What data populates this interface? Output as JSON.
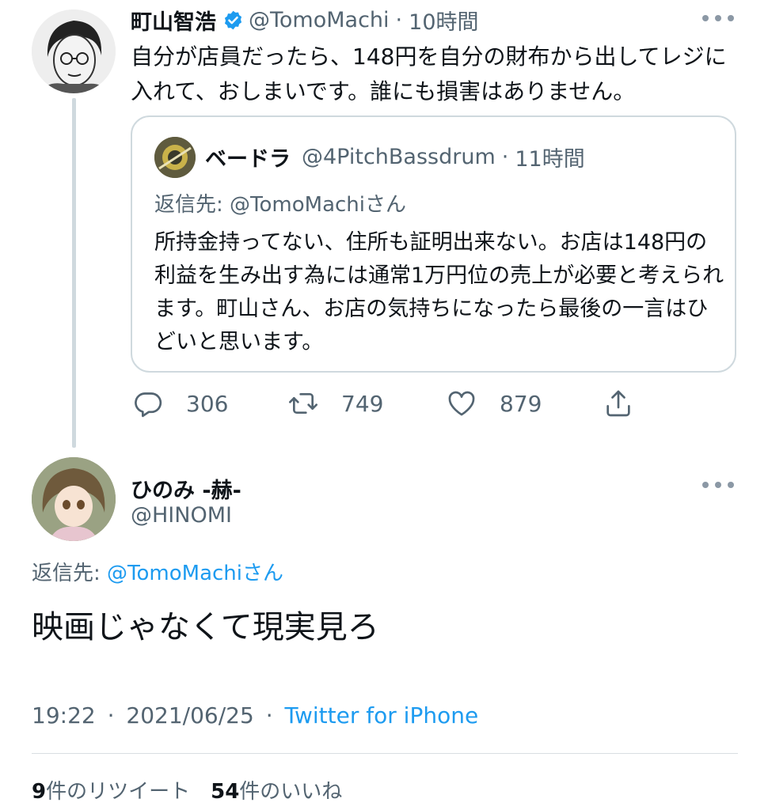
{
  "original_tweet": {
    "author_name": "町山智浩",
    "handle": "@TomoMachi",
    "separator": "·",
    "time_ago": "10時間",
    "text": "自分が店員だったら、148円を自分の財布から出してレジに入れて、おしまいです。誰にも損害はありません。",
    "quoted_tweet": {
      "author_name": "ベードラ",
      "handle": "@4PitchBassdrum",
      "separator": "·",
      "time_ago": "11時間",
      "reply_prefix": "返信先: ",
      "reply_target": "@TomoMachiさん",
      "text": "所持金持ってない、住所も証明出来ない。お店は148円の利益を生み出す為には通常1万円位の売上が必要と考えられます。町山さん、お店の気持ちになったら最後の一言はひどいと思います。"
    },
    "actions": {
      "reply_count": "306",
      "retweet_count": "749",
      "like_count": "879"
    }
  },
  "reply_tweet": {
    "author_name": "ひのみ -赫-",
    "handle": "@HINOMI",
    "reply_prefix": "返信先: ",
    "reply_target": "@TomoMachiさん",
    "text": "映画じゃなくて現実見ろ",
    "time": "19:22",
    "separator": "·",
    "date": "2021/06/25",
    "source": "Twitter for iPhone",
    "retweet_count": "9",
    "retweet_label": "件のリツイート",
    "like_count": "54",
    "like_label": "件のいいね"
  },
  "colors": {
    "link": "#1d9bf0",
    "muted_text": "#536471",
    "verified": "#1d9bf0",
    "border": "#cfd9de"
  },
  "icons": [
    "verified-badge-icon",
    "more-options-icon",
    "reply-icon",
    "retweet-icon",
    "like-icon",
    "share-icon"
  ]
}
